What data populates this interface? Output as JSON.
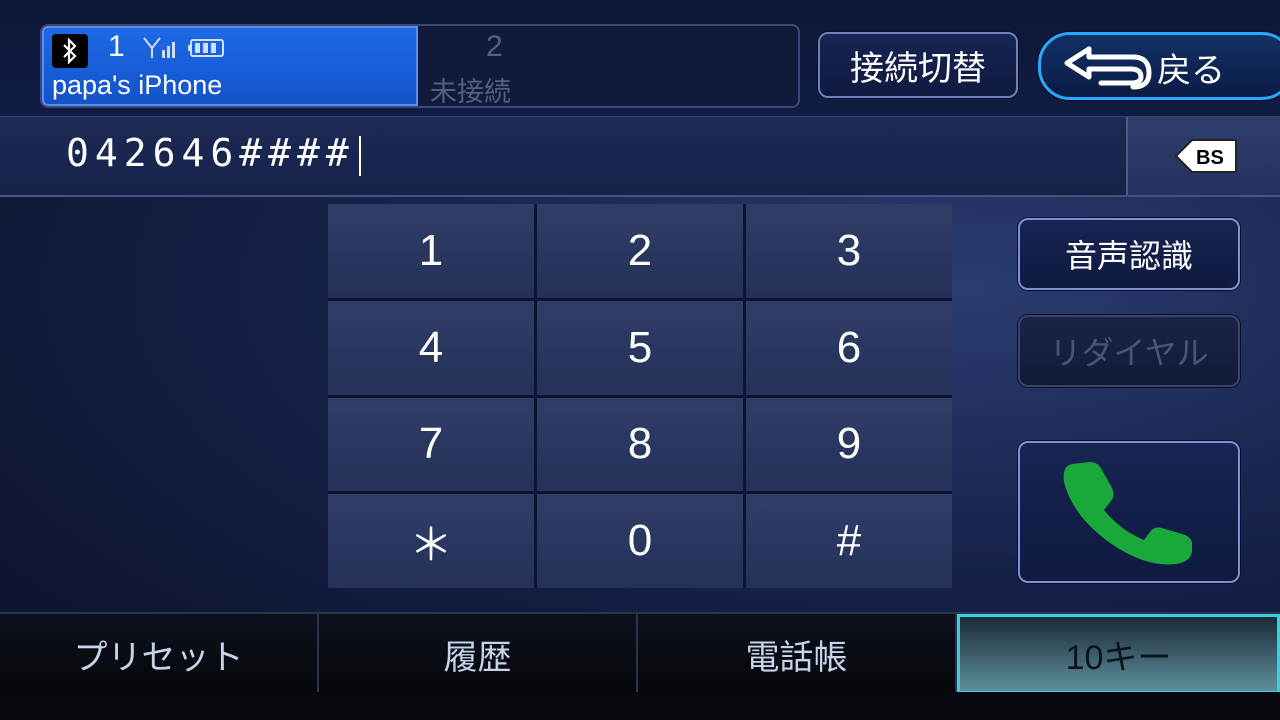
{
  "devices": [
    {
      "number": "1",
      "name": "papa's iPhone",
      "connected": true
    },
    {
      "number": "2",
      "name": "未接続",
      "connected": false
    }
  ],
  "header": {
    "switch_label": "接続切替",
    "back_label": "戻る"
  },
  "input": {
    "number": "042646####",
    "bs_label": "BS"
  },
  "keypad": [
    "1",
    "2",
    "3",
    "4",
    "5",
    "6",
    "7",
    "8",
    "9",
    "＊",
    "0",
    "#"
  ],
  "side": {
    "voice_label": "音声認識",
    "redial_label": "リダイヤル"
  },
  "tabs": [
    {
      "label": "プリセット",
      "active": false
    },
    {
      "label": "履歴",
      "active": false
    },
    {
      "label": "電話帳",
      "active": false
    },
    {
      "label": "10キー",
      "active": true
    }
  ],
  "colors": {
    "accent": "#29a8ff",
    "device_active": "#1f6ae8",
    "call_green": "#1aa83a",
    "tab_active_border": "#36d0e0"
  },
  "icons": {
    "bluetooth": "bluetooth-icon",
    "signal": "signal-icon",
    "battery": "battery-icon",
    "back": "return-arrow-icon",
    "backspace": "backspace-icon",
    "call": "phone-handset-icon"
  }
}
